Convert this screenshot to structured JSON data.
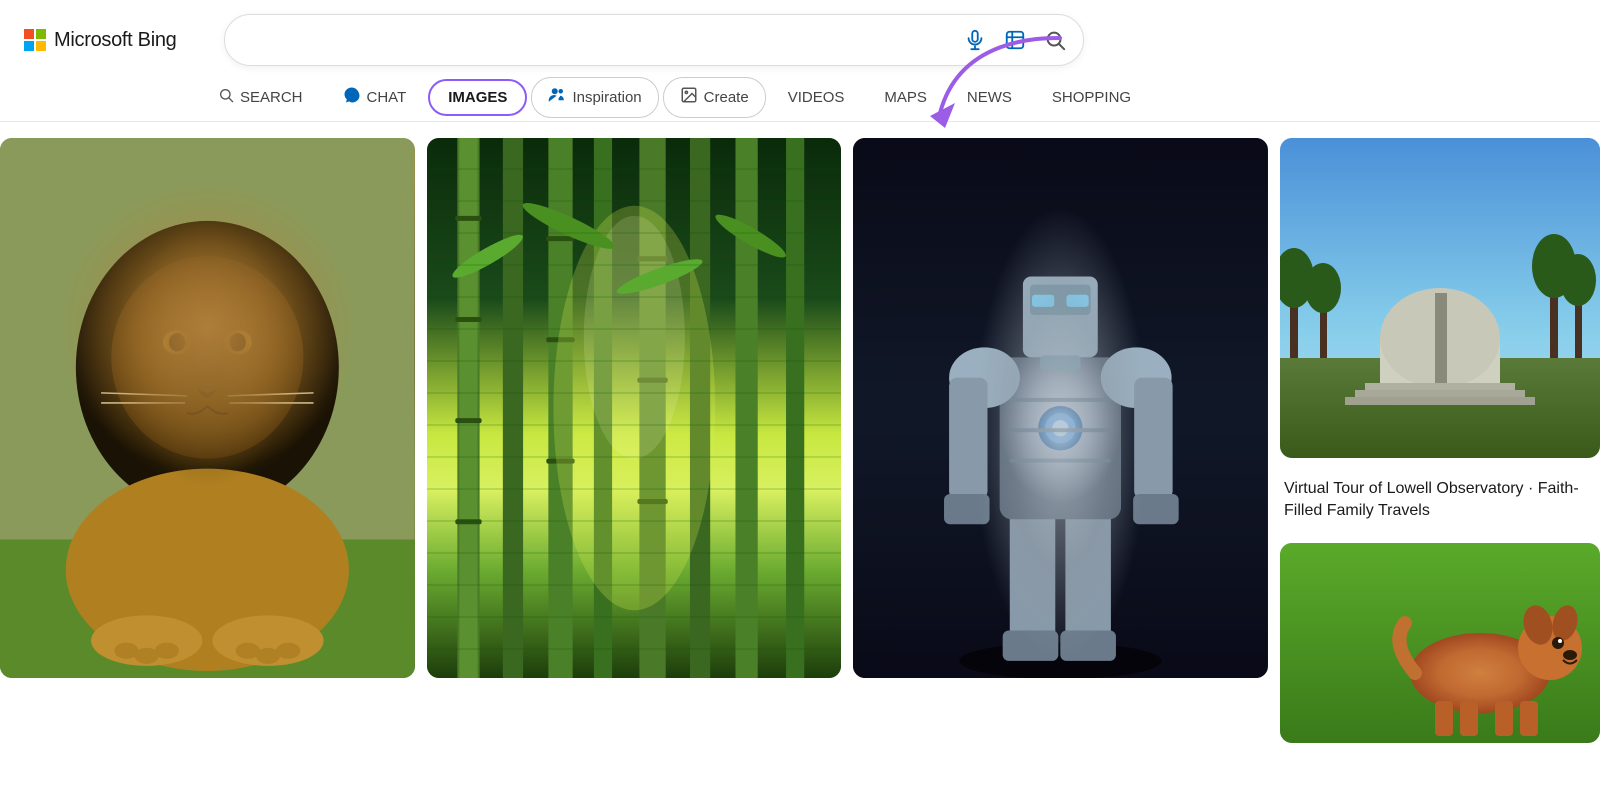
{
  "logo": {
    "brand": "Microsoft Bing"
  },
  "search": {
    "placeholder": "",
    "value": ""
  },
  "nav": {
    "tabs": [
      {
        "id": "search",
        "label": "SEARCH",
        "icon": "🔍",
        "active": false,
        "pill": false
      },
      {
        "id": "chat",
        "label": "CHAT",
        "icon": "💬",
        "active": false,
        "pill": false
      },
      {
        "id": "images",
        "label": "IMAGES",
        "icon": "",
        "active": true,
        "pill": false
      },
      {
        "id": "inspiration",
        "label": "Inspiration",
        "icon": "👥",
        "active": false,
        "pill": true
      },
      {
        "id": "create",
        "label": "Create",
        "icon": "🖼",
        "active": false,
        "pill": true
      },
      {
        "id": "videos",
        "label": "VIDEOS",
        "icon": "",
        "active": false,
        "pill": false
      },
      {
        "id": "maps",
        "label": "MAPS",
        "icon": "",
        "active": false,
        "pill": false
      },
      {
        "id": "news",
        "label": "NEWS",
        "icon": "",
        "active": false,
        "pill": false
      },
      {
        "id": "shopping",
        "label": "SHOPPING",
        "icon": "",
        "active": false,
        "pill": false
      }
    ]
  },
  "images": {
    "col4": {
      "title": "Virtual Tour of Lowell Observatory · Faith-Filled Family Travels"
    }
  },
  "icons": {
    "mic": "🎤",
    "camera": "⊡",
    "search": "🔍"
  }
}
